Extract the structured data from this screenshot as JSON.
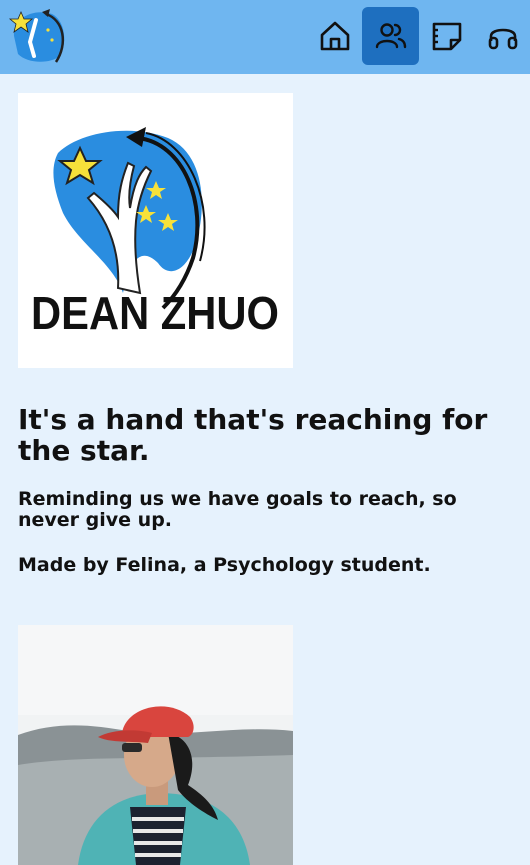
{
  "header": {
    "logo_icon": "hand-reaching-star-logo",
    "nav": [
      {
        "icon": "home-icon",
        "label": "Home",
        "active": false
      },
      {
        "icon": "people-icon",
        "label": "About",
        "active": true
      },
      {
        "icon": "sticky-note-icon",
        "label": "Notes",
        "active": false
      },
      {
        "icon": "headphones-icon",
        "label": "Support",
        "active": false
      }
    ]
  },
  "logo_card": {
    "brand_text": "DEAN ZHUO"
  },
  "content": {
    "heading": "It's a hand that's reaching for the star.",
    "description": "Reminding us we have goals to reach, so never give up.",
    "credit": "Made by Felina, a Psychology student."
  },
  "colors": {
    "topbar": "#6fb6f0",
    "active_nav": "#1e6fbf",
    "background": "#e6f2fd",
    "logo_blue": "#2a8de0",
    "star_yellow": "#f7e13a",
    "cap_red": "#d9453e",
    "jacket_teal": "#4fb3b5"
  }
}
